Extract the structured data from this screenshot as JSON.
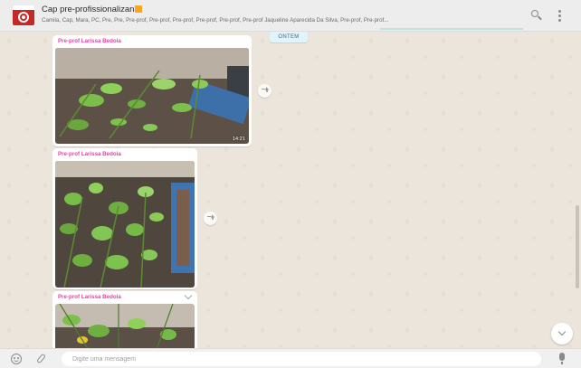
{
  "header": {
    "title": "Cap pre-profissionalizan",
    "participants": "Camila, Cap, Mara, PC, Pre, Pre, Pre-prof, Pre-prof, Pre-prof, Pre-prof, Pre-prof, Pre-prof Jaqueline Aparecida Da Silva, Pre-prof, Pre-prof..."
  },
  "chat": {
    "date_chip": "ONTEM",
    "messages": [
      {
        "sender": "Pre-prof Larissa Bedoia",
        "time": "14:21",
        "photo": "Plant seedlings in a blue planter box"
      },
      {
        "sender": "Pre-prof Larissa Bedoia",
        "time": "",
        "photo": "Plant seedlings in a blue planter box"
      },
      {
        "sender": "Pre-prof Larissa Bedoia",
        "time": "",
        "photo": "Plant seedlings in a blue planter box"
      }
    ]
  },
  "footer": {
    "input_placeholder": "Digite uma mensagem"
  },
  "colors": {
    "header_bg": "#ededed",
    "chat_bg": "#ece5dc",
    "sender_name": "#e542a3",
    "date_chip_bg": "#e1f3fb",
    "footer_bg": "#f0f0f0"
  },
  "icons": [
    "group-avatar",
    "search-icon",
    "menu-icon",
    "forward-icon",
    "chevron-down-icon",
    "emoji-icon",
    "attach-icon",
    "mic-icon"
  ]
}
